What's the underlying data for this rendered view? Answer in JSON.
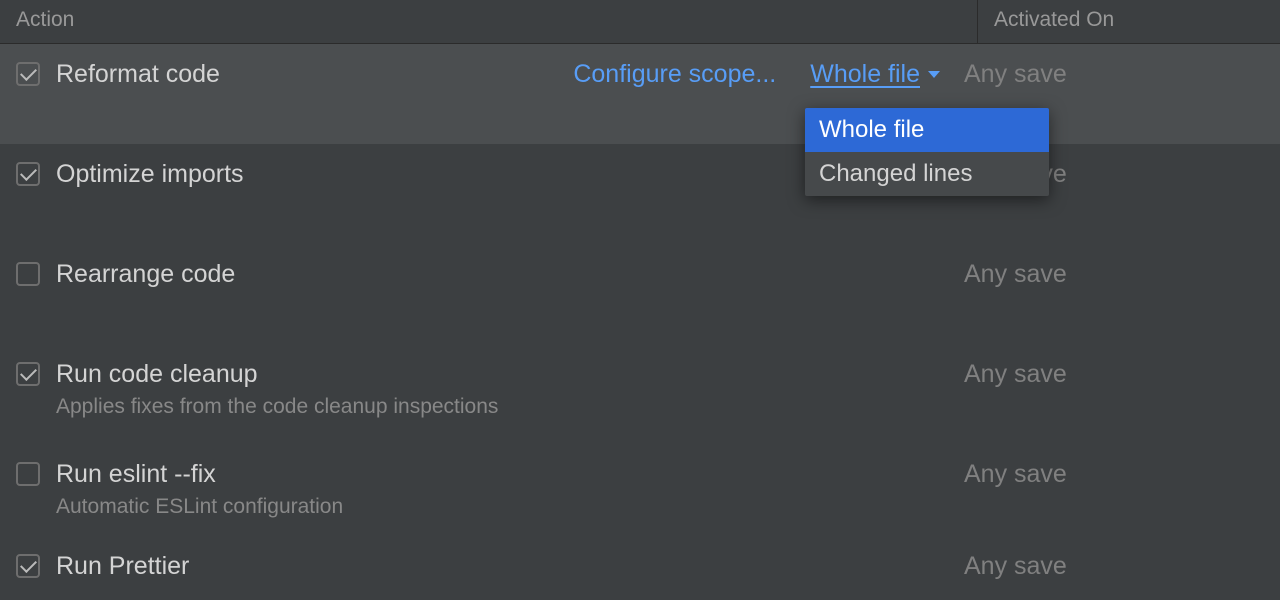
{
  "headers": {
    "action": "Action",
    "activated": "Activated On"
  },
  "rows": [
    {
      "checked": true,
      "label": "Reformat code",
      "desc": "",
      "activated": "Any save",
      "configure_scope": "Configure scope...",
      "scope_value": "Whole file"
    },
    {
      "checked": true,
      "label": "Optimize imports",
      "desc": "",
      "activated": "Any save"
    },
    {
      "checked": false,
      "label": "Rearrange code",
      "desc": "",
      "activated": "Any save"
    },
    {
      "checked": true,
      "label": "Run code cleanup",
      "desc": "Applies fixes from the code cleanup inspections",
      "activated": "Any save"
    },
    {
      "checked": false,
      "label": "Run eslint --fix",
      "desc": "Automatic ESLint configuration",
      "activated": "Any save"
    },
    {
      "checked": true,
      "label": "Run Prettier",
      "desc": "",
      "activated": "Any save"
    }
  ],
  "dropdown": {
    "options": [
      "Whole file",
      "Changed lines"
    ],
    "selected": "Whole file"
  }
}
